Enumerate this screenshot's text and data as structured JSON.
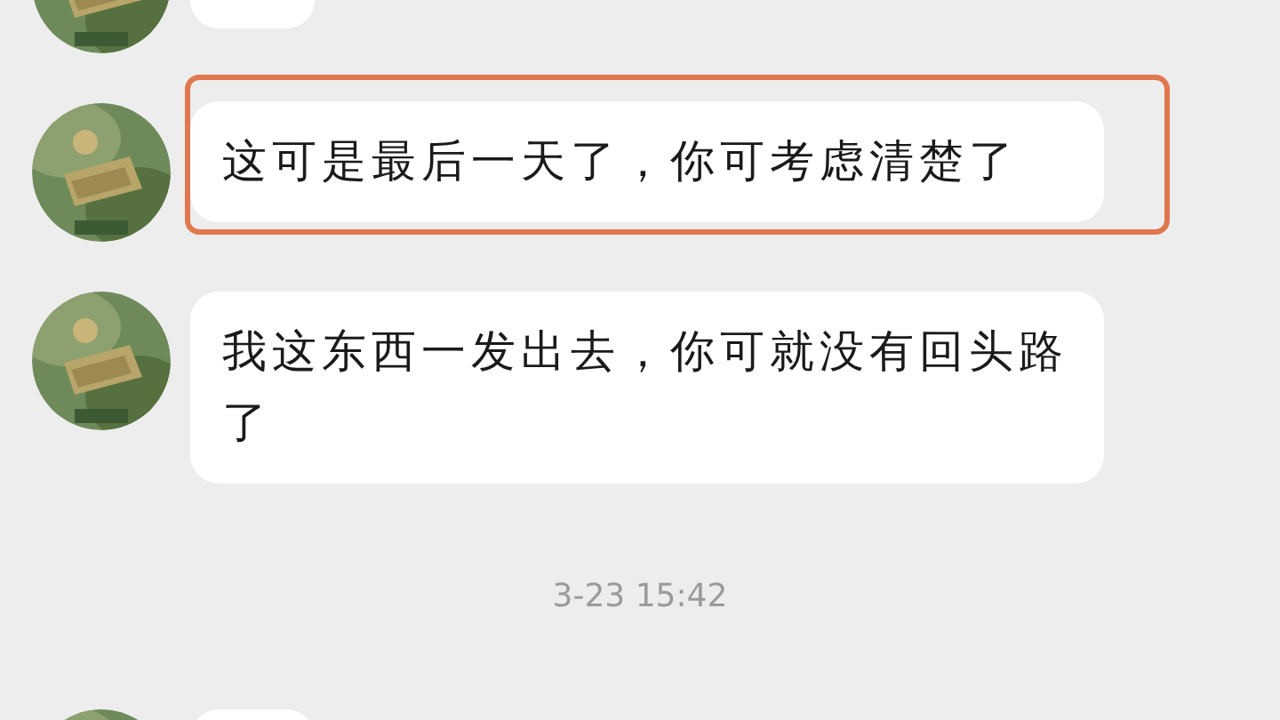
{
  "messages": [
    {
      "kind": "message",
      "highlighted": false
    },
    {
      "kind": "message",
      "highlighted": true,
      "text": "这可是最后一天了，你可考虑清楚了"
    },
    {
      "kind": "message",
      "highlighted": false,
      "text": "我这东西一发出去，你可就没有回头路了"
    },
    {
      "kind": "time",
      "text": "3-23 15:42"
    },
    {
      "kind": "message",
      "highlighted": false
    }
  ]
}
